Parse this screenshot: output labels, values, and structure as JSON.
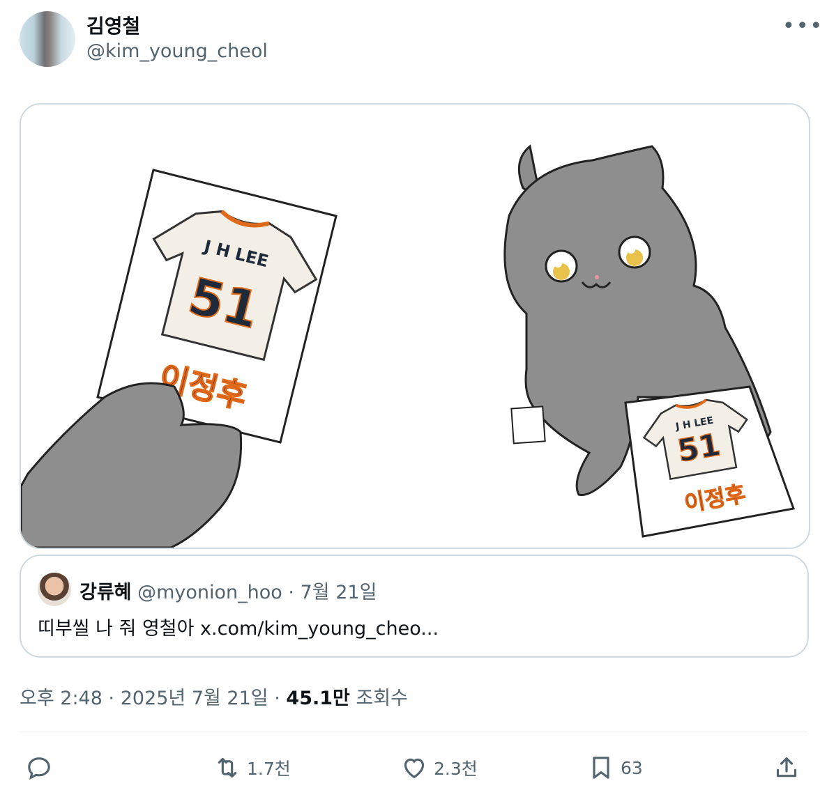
{
  "author": {
    "name": "김영철",
    "handle": "@kim_young_cheol"
  },
  "media": {
    "card_left": {
      "jersey_name": "J H LEE",
      "jersey_number": "51",
      "caption": "이정후"
    },
    "card_right": {
      "jersey_name": "J H LEE",
      "jersey_number": "51",
      "caption": "이정후"
    }
  },
  "quote": {
    "name": "강류혜",
    "handle": "@myonion_hoo",
    "date": "7월 21일",
    "text": "띠부씰 나 줘 영철아 x.com/kim_young_cheo..."
  },
  "meta": {
    "time": "오후 2:48",
    "date": "2025년 7월 21일",
    "views_count": "45.1만",
    "views_label": "조회수"
  },
  "actions": {
    "reply_count": "",
    "retweet_count": "1.7천",
    "like_count": "2.3천",
    "bookmark_count": "63"
  },
  "colors": {
    "secondary_text": "#536471",
    "border": "#cfd9de",
    "cat_gray": "#8e8e8e",
    "jersey_orange": "#e06a1a",
    "jersey_navy": "#1e2a3a"
  }
}
